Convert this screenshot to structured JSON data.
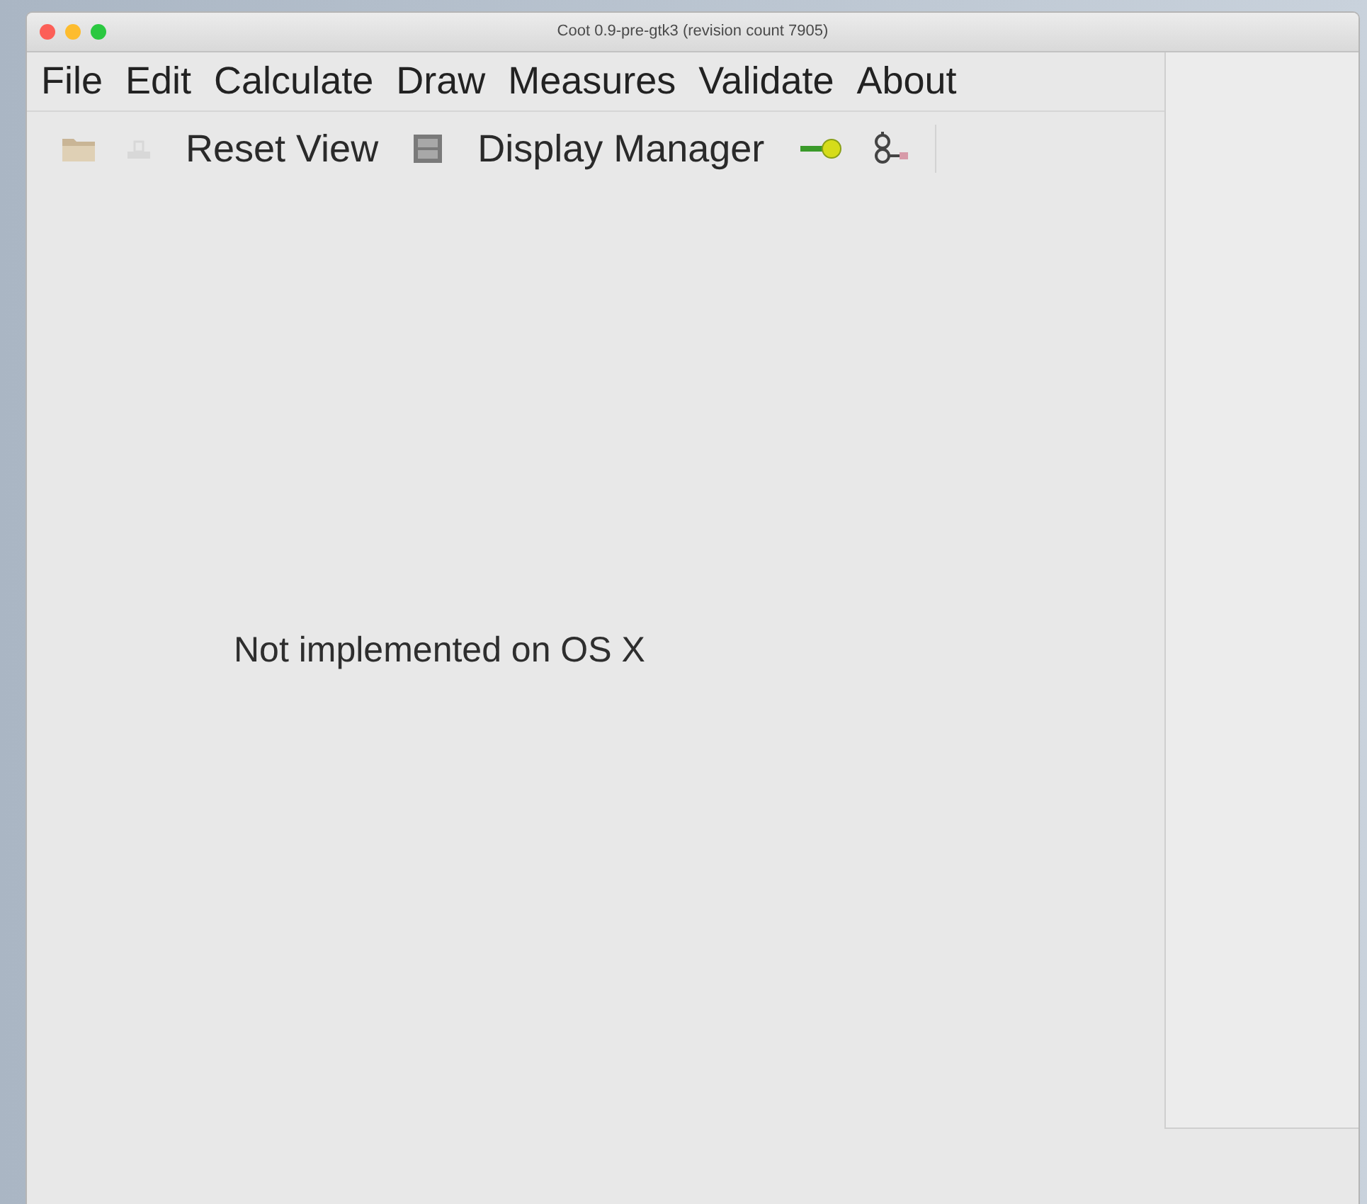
{
  "window": {
    "title": "Coot 0.9-pre-gtk3 (revision count 7905)"
  },
  "menu": [
    "File",
    "Edit",
    "Calculate",
    "Draw",
    "Measures",
    "Validate",
    "About"
  ],
  "toolbar": [
    {
      "kind": "open",
      "disabled": false
    },
    {
      "kind": "save",
      "disabled": true
    },
    {
      "kind": "text",
      "label": "Reset View",
      "disabled": false
    },
    {
      "kind": "panel",
      "disabled": false
    },
    {
      "kind": "text",
      "label": "Display Manager",
      "disabled": false
    },
    {
      "kind": "key",
      "disabled": false
    },
    {
      "kind": "molecule",
      "disabled": false
    }
  ],
  "canvas": {
    "message": "Not implemented on OS X"
  }
}
